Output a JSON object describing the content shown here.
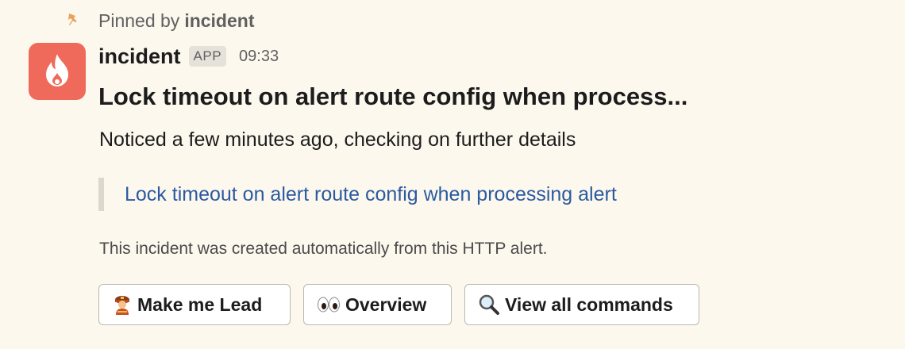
{
  "pinned": {
    "prefix": "Pinned by",
    "by": "incident",
    "icon": "pushpin-icon"
  },
  "message": {
    "sender": "incident",
    "badge": "APP",
    "time": "09:33",
    "avatar_icon": "flame-icon",
    "avatar_color": "#ef6a5a",
    "title": "Lock timeout on alert route config when process...",
    "body": "Noticed a few minutes ago, checking on further details",
    "quote_link": "Lock timeout on alert route config when processing alert",
    "context": "This incident was created automatically from this HTTP alert."
  },
  "buttons": [
    {
      "label": "Make me Lead",
      "icon": "firefighter-emoji"
    },
    {
      "label": "Overview",
      "icon": "eyes-emoji"
    },
    {
      "label": "View all commands",
      "icon": "magnifying-glass-emoji"
    }
  ],
  "colors": {
    "link": "#2b5aa0",
    "pin": "#e8a25a"
  }
}
